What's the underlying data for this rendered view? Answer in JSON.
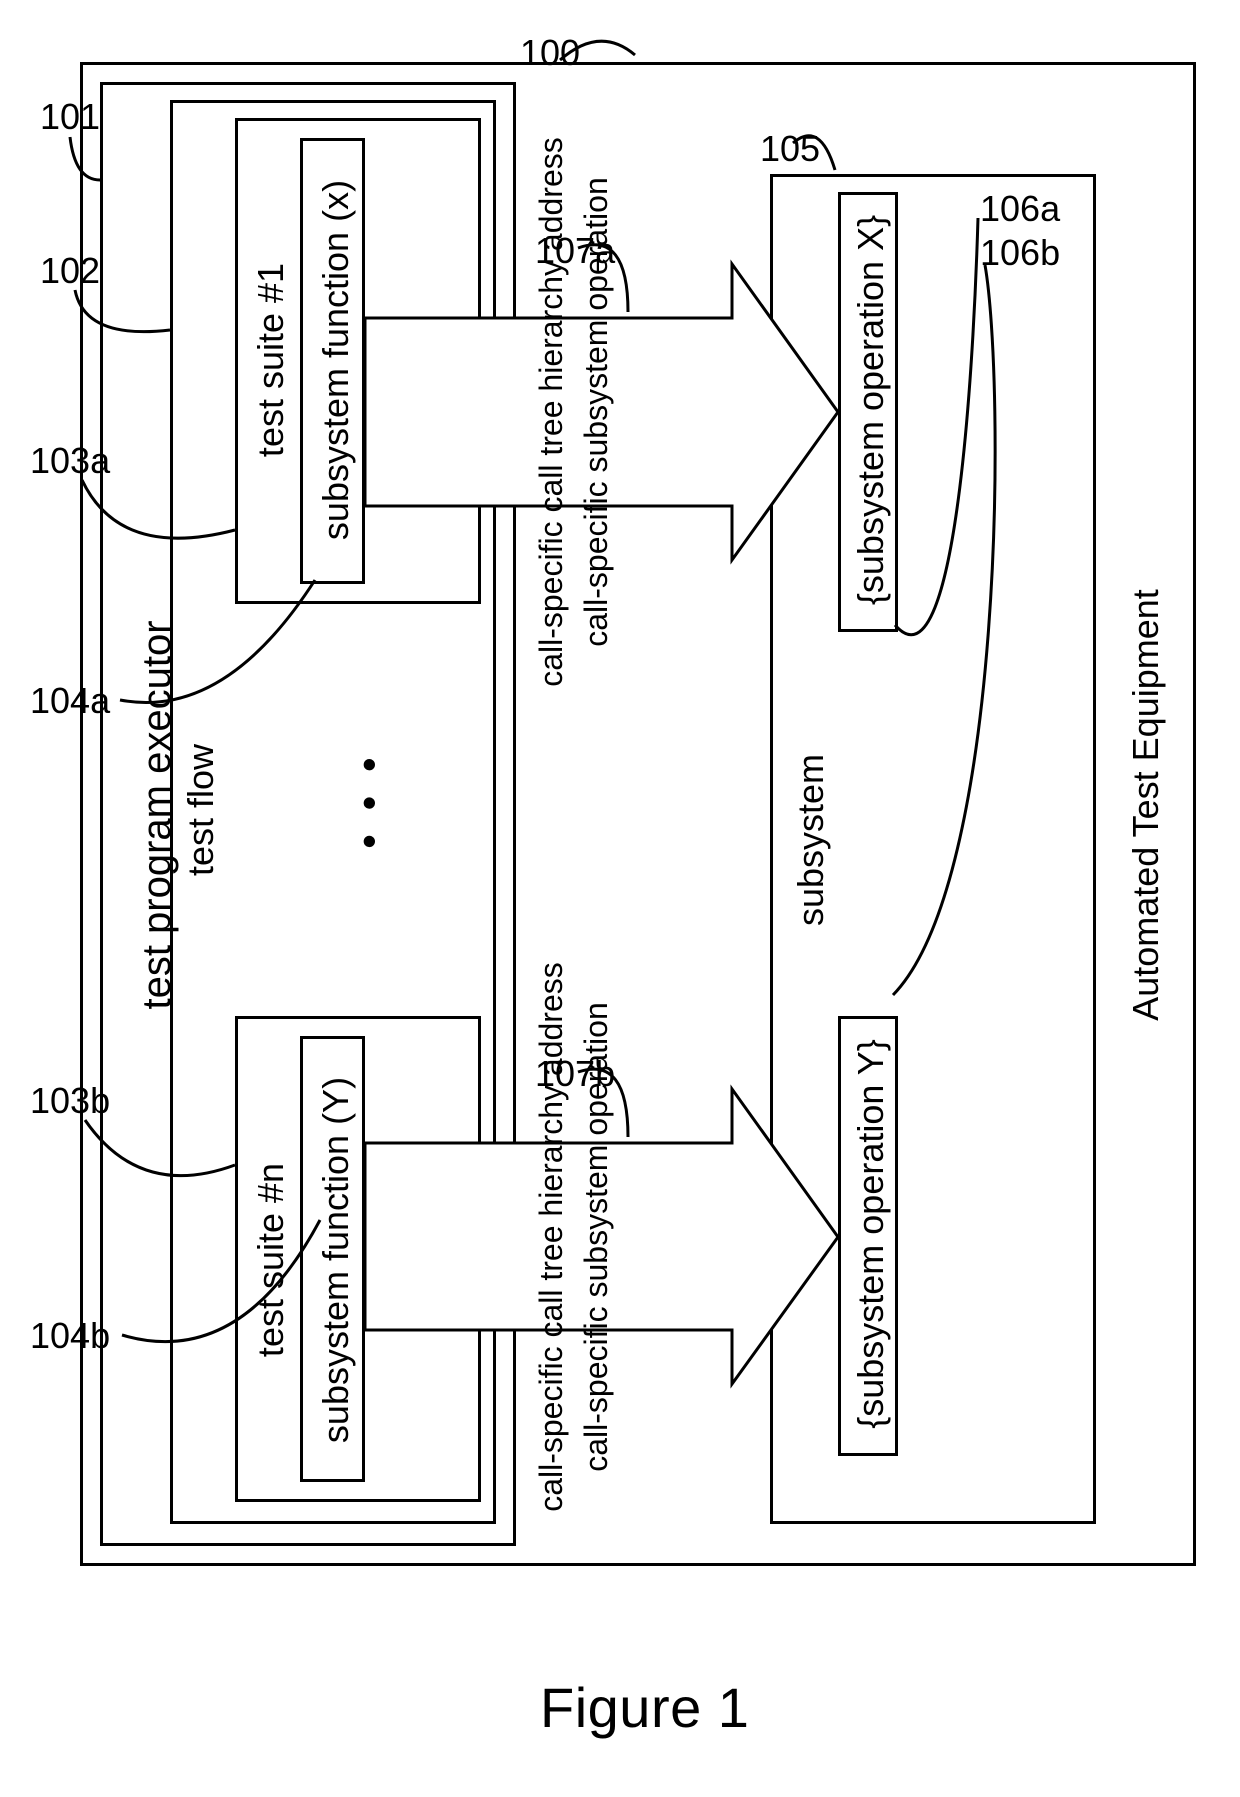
{
  "figure_caption": "Figure 1",
  "outer": {
    "title": "Automated Test Equipment",
    "ref": "100"
  },
  "executor": {
    "title": "test program executor",
    "ref": "101",
    "flow": {
      "title": "test flow",
      "ref": "102",
      "suites": [
        {
          "suite_title": "test suite #1",
          "suite_ref": "103a",
          "func_title": "subsystem function (x)",
          "func_ref": "104a"
        },
        {
          "suite_title": "test suite #n",
          "suite_ref": "103b",
          "func_title": "subsystem function (Y)",
          "func_ref": "104b"
        }
      ],
      "ellipsis": "• • •"
    }
  },
  "arrows": [
    {
      "text1": "call-specific call tree hierarchy address",
      "text2": "call-specific subsystem operation",
      "ref": "107a"
    },
    {
      "text1": "call-specific call tree hierarchy address",
      "text2": "call-specific subsystem operation",
      "ref": "107b"
    }
  ],
  "subsystem": {
    "title": "subsystem",
    "ref": "105",
    "ops": [
      {
        "label": "{subsystem operation X}",
        "ref": "106a"
      },
      {
        "label": "{subsystem operation Y}",
        "ref": "106b"
      }
    ]
  }
}
